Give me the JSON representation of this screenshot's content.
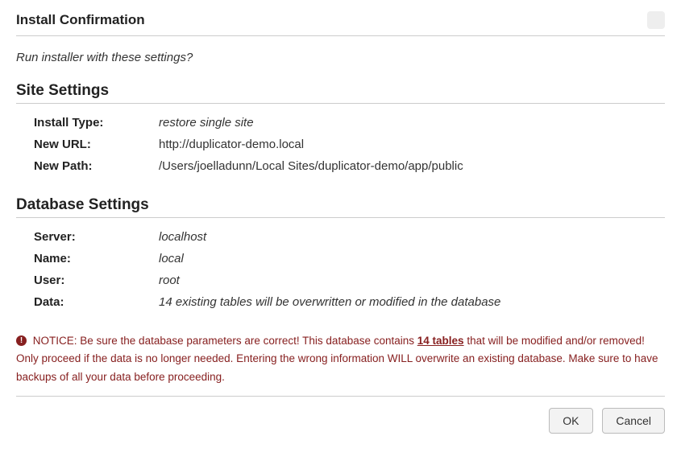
{
  "header": {
    "title": "Install Confirmation"
  },
  "prompt": "Run installer with these settings?",
  "site_settings": {
    "heading": "Site Settings",
    "rows": {
      "install_type": {
        "label": "Install Type:",
        "value": "restore single site"
      },
      "new_url": {
        "label": "New URL:",
        "value": "http://duplicator-demo.local"
      },
      "new_path": {
        "label": "New Path:",
        "value": "/Users/joelladunn/Local Sites/duplicator-demo/app/public"
      }
    }
  },
  "database_settings": {
    "heading": "Database Settings",
    "rows": {
      "server": {
        "label": "Server:",
        "value": "localhost"
      },
      "name": {
        "label": "Name:",
        "value": "local"
      },
      "user": {
        "label": "User:",
        "value": "root"
      },
      "data": {
        "label": "Data:",
        "value": "14 existing tables will be overwritten or modified in the database"
      }
    }
  },
  "notice": {
    "prefix": "NOTICE: Be sure the database parameters are correct! This database contains ",
    "table_count": "14 tables",
    "suffix": " that will be modified and/or removed! Only proceed if the data is no longer needed. Entering the wrong information WILL overwrite an existing database. Make sure to have backups of all your data before proceeding."
  },
  "buttons": {
    "ok": "OK",
    "cancel": "Cancel"
  }
}
